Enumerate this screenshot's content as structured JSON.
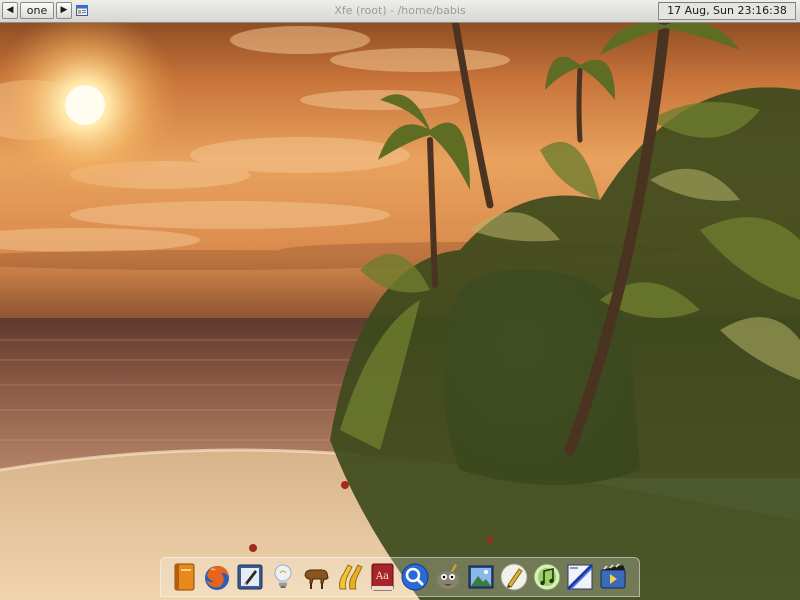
{
  "top_panel": {
    "prev_desktop_icon": "left-arrow-icon",
    "desktop_name": "one",
    "next_desktop_icon": "right-arrow-icon",
    "task_icon": "xfe-window-icon",
    "window_title": "Xfe (root) - /home/babis",
    "clock": "17 Aug, Sun 23:16:38"
  },
  "dock": {
    "items": [
      {
        "icon": "notebook-icon"
      },
      {
        "icon": "firefox-icon"
      },
      {
        "icon": "text-editor-icon"
      },
      {
        "icon": "lightbulb-icon"
      },
      {
        "icon": "gnu-icon"
      },
      {
        "icon": "tool-icon"
      },
      {
        "icon": "dictionary-icon",
        "text": "Aa"
      },
      {
        "icon": "search-icon"
      },
      {
        "icon": "gimp-icon"
      },
      {
        "icon": "image-viewer-icon"
      },
      {
        "icon": "pen-icon"
      },
      {
        "icon": "music-player-icon"
      },
      {
        "icon": "drawing-icon"
      },
      {
        "icon": "media-player-icon"
      }
    ]
  },
  "colors": {
    "panel_background": "#e0e0dc",
    "title_text": "#9b9b97",
    "sky_glow": "#f6c27a",
    "sand": "#e2c39a"
  }
}
